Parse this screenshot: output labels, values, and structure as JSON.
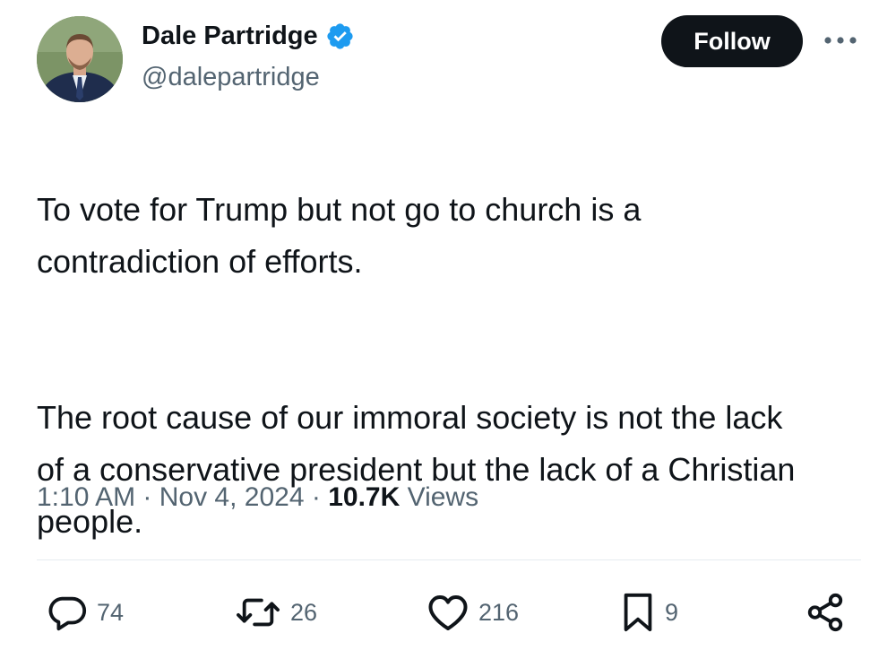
{
  "author": {
    "name": "Dale Partridge",
    "handle": "@dalepartridge",
    "verified": true
  },
  "follow_label": "Follow",
  "tweet": {
    "paragraphs": [
      "To vote for Trump but not go to church is a\ncontradiction of efforts.",
      "The root cause of our immoral society is not the lack\nof a conservative president but the lack of a Christian\npeople."
    ]
  },
  "meta": {
    "time": "1:10 AM",
    "sep1": " · ",
    "date": "Nov 4, 2024",
    "sep2": " · ",
    "views_count": "10.7K",
    "views_label": " Views"
  },
  "actions": {
    "replies": "74",
    "reposts": "26",
    "likes": "216",
    "bookmarks": "9"
  },
  "colors": {
    "text": "#0f1419",
    "secondary": "#536471",
    "verified_blue": "#1d9bf0",
    "follow_bg": "#0f1419"
  }
}
